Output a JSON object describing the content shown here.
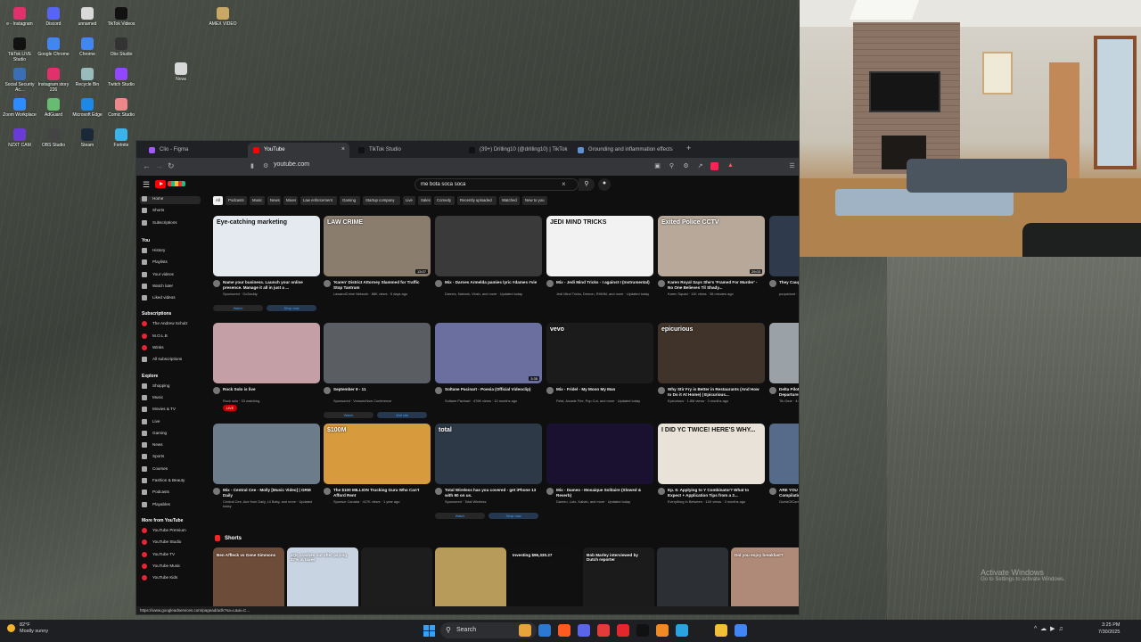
{
  "desktop": {
    "icons": [
      {
        "label": "e - Instagram"
      },
      {
        "label": "Discord"
      },
      {
        "label": "unnamed"
      },
      {
        "label": "TikTok Videos"
      },
      {
        "label": "TikTok LIVE Studio"
      },
      {
        "label": "Google Chrome"
      },
      {
        "label": "Chrome"
      },
      {
        "label": "Obs Studio"
      },
      {
        "label": "Social Security Ac..."
      },
      {
        "label": "Instagram story 226"
      },
      {
        "label": "Recycle Bin"
      },
      {
        "label": "Twitch Studio"
      },
      {
        "label": "Zoom Workplace"
      },
      {
        "label": "AdGuard"
      },
      {
        "label": "Microsoft Edge"
      },
      {
        "label": "Comic Studio"
      },
      {
        "label": "NZXT CAM"
      },
      {
        "label": "OBS Studio"
      },
      {
        "label": "Steam"
      },
      {
        "label": "Fortnite"
      }
    ],
    "top_label": "AMEX VIDEO",
    "mid_label": "Nova"
  },
  "browser": {
    "tabs": [
      {
        "label": "Clio - Figma",
        "color": "#a259ff"
      },
      {
        "label": "YouTube",
        "color": "#ff0000",
        "active": true
      },
      {
        "label": "TikTok Studio",
        "color": "#111111"
      },
      {
        "label": "(39+) Drilling10 (@drilling10) | TikTok",
        "color": "#111111"
      },
      {
        "label": "Grounding and inflammation effects",
        "color": "#5f8fd6"
      }
    ],
    "url": "youtube.com"
  },
  "youtube": {
    "search_query": "me bota soca soca",
    "sidebar": {
      "main": [
        "Home",
        "Shorts",
        "Subscriptions"
      ],
      "you_heading": "You",
      "you": [
        "History",
        "Playlists",
        "Your videos",
        "Watch later",
        "Liked videos"
      ],
      "subs_heading": "Subscriptions",
      "subs": [
        "The Andrew Schulz",
        "M.O.L.B",
        "Winks",
        "All subscriptions"
      ],
      "explore_heading": "Explore",
      "explore": [
        "Shopping",
        "Music",
        "Movies & TV",
        "Live",
        "Gaming",
        "News",
        "Sports",
        "Courses",
        "Fashion & Beauty",
        "Podcasts",
        "Playables"
      ],
      "more_heading": "More from YouTube",
      "more": [
        "YouTube Premium",
        "YouTube Studio",
        "YouTube TV",
        "YouTube Music",
        "YouTube Kids"
      ]
    },
    "chips": [
      "All",
      "Podcasts",
      "Music",
      "News",
      "Mixes",
      "Law enforcement",
      "Gaming",
      "Startup company",
      "Live",
      "Sales",
      "Comedy",
      "Recently uploaded",
      "Watched",
      "New to you"
    ],
    "videos": [
      {
        "title": "Name your business. Launch your online presence. Manage it all in just a ...",
        "meta": "Sponsored · GoDaddy",
        "thumb": "#e4eaf0",
        "caption": "Eye-catching marketing",
        "btn1": "Watch",
        "btn2": "Shop now"
      },
      {
        "title": "'Karen' District Attorney Slammed for Traffic Stop Tantrum",
        "meta": "LawandCrime Network · 88K views · 5 days ago",
        "thumb": "#8a7d6e",
        "caption": "LAW CRIME",
        "dur": "13:07"
      },
      {
        "title": "Mix - Darnes Armelda pamies lyric #dames #vie",
        "meta": "Darnes, Nabosk, Viosh, and more · Updated today",
        "thumb": "#3a3a3a",
        "caption": ""
      },
      {
        "title": "Mix - Jedi Mind Tricks - I against I (Instrumental)",
        "meta": "Jedi Mind Tricks, Demon, RHMM, and more · Updated today",
        "thumb": "#f2f2f2",
        "caption": "JEDI MIND TRICKS"
      },
      {
        "title": "Karen Royal Says She's 'Framed For Murder' - No One Believes Til Shady...",
        "meta": "Karen Squad · 11K views · 38 minutes ago",
        "thumb": "#b7a89a",
        "caption": "Exited Police CCTV",
        "dur": "29:03"
      },
      {
        "title": "They Caught Him",
        "meta": "poopshoot · 11 hours ago",
        "thumb": "#2f3b4c",
        "caption": ""
      },
      {
        "title": "Rock Solo is live",
        "meta": "Rock solo · 33 watching",
        "thumb": "#c4a0a6",
        "caption": "",
        "live": "LIVE"
      },
      {
        "title": "September 9 - 11",
        "meta": "Sponsored · VorssenNow Conference",
        "thumb": "#5a5d62",
        "caption": "",
        "btn1": "Watch",
        "btn2": "Visit site"
      },
      {
        "title": "Soltane Pacinart - Poesia (Official Videoclip)",
        "meta": "Soltane Pacinart · 476K views · 10 months ago",
        "thumb": "#6b6fa0",
        "caption": "",
        "dur": "3:35"
      },
      {
        "title": "Mix - Fridel - My Moon My Man",
        "meta": "Feist, Arcade Fire, Pop Cut, and more · Updated today",
        "thumb": "#1b1b1b",
        "caption": "vevo"
      },
      {
        "title": "Why Stir Fry is Better in Restaurants (And How to Do it At Home) | Epicurious...",
        "meta": "Epicurious · 1.8M views · 3 months ago",
        "thumb": "#40342a",
        "caption": "epicurious"
      },
      {
        "title": "Delta Pilot Arrested 20 Minutes Before Departure",
        "meta": "Tik Gear · 4.6M views · 3 days ago",
        "thumb": "#9aa2a8",
        "caption": "",
        "dur": "15:24"
      },
      {
        "title": "Mix - Central Cee - Molly [Music Video] | GRM Daily",
        "meta": "Central Cee, Ace from Daily, Lil Baby, and more · Updated today",
        "thumb": "#6d7c8a",
        "caption": ""
      },
      {
        "title": "The $100 MILLION Trucking Guru Who Can't Afford Rent",
        "meta": "Sponsor Canada · 417K views · 1 year ago",
        "thumb": "#d79a3c",
        "caption": "$100M"
      },
      {
        "title": "Total Wireless has you covered - get iPhone 13 with 90 on us.",
        "meta": "Sponsored · Total Wireless",
        "thumb": "#2d3947",
        "caption": "total",
        "btn1": "Watch",
        "btn2": "Shop now"
      },
      {
        "title": "Mix - Dameo - Mosaique Solitaire (Slowed & Reverb)",
        "meta": "Dameo, Lufo, Kabah, and more · Updated today",
        "thumb": "#1a1030",
        "caption": ""
      },
      {
        "title": "Ep. 5: Applying to Y Combinator? What to Expect + Application Tips from a 2...",
        "meta": "Everything In Between · 14K views · 3 months ago",
        "thumb": "#e9e2d8",
        "caption": "I DID YC TWICE! HERE'S WHY..."
      },
      {
        "title": "ARE YOU SERIOUS?! - Norm Macdonald | Compilation",
        "meta": "GuestOfCanvasses · 184K views · 4 years ago",
        "thumb": "#566a8a",
        "caption": "",
        "dur": "17:58"
      }
    ],
    "shorts_heading": "Shorts",
    "shorts": [
      {
        "label": "Ben Affleck vs Gene Simmons",
        "color": "#6e4c3a"
      },
      {
        "label": "xQc crashes out after paying 37% in taxes",
        "color": "#c9d4e2"
      },
      {
        "label": "",
        "color": "#1d1d1d"
      },
      {
        "label": "",
        "color": "#b69b5a"
      },
      {
        "label": "Investing $96,330.27",
        "color": "#101010"
      },
      {
        "label": "Bob Marley interviewed by Dutch reporter",
        "color": "#1b1b1b"
      },
      {
        "label": "",
        "color": "#2c2f33"
      },
      {
        "label": "Did you enjoy breakfast?",
        "color": "#b08a78"
      },
      {
        "label": "",
        "color": "#4f3b2e"
      }
    ],
    "status_url": "https://www.googleadservices.com/pagead/aclk?sa=L&ai=C..."
  },
  "watermark": {
    "line1": "Activate Windows",
    "line2": "Go to Settings to activate Windows."
  },
  "taskbar": {
    "weather_temp": "82°F",
    "weather_desc": "Mostly sunny",
    "search_label": "Search",
    "apps": [
      "#e8a33a",
      "#2b79d0",
      "#ff5a1f",
      "#5b65ea",
      "#e33a3a",
      "#e5262d",
      "#111111",
      "#f08a24",
      "#2ba3df",
      "#1f1f1f",
      "#f2c037",
      "#4285f4"
    ],
    "time": "3:25 PM",
    "date": "7/30/2025"
  }
}
